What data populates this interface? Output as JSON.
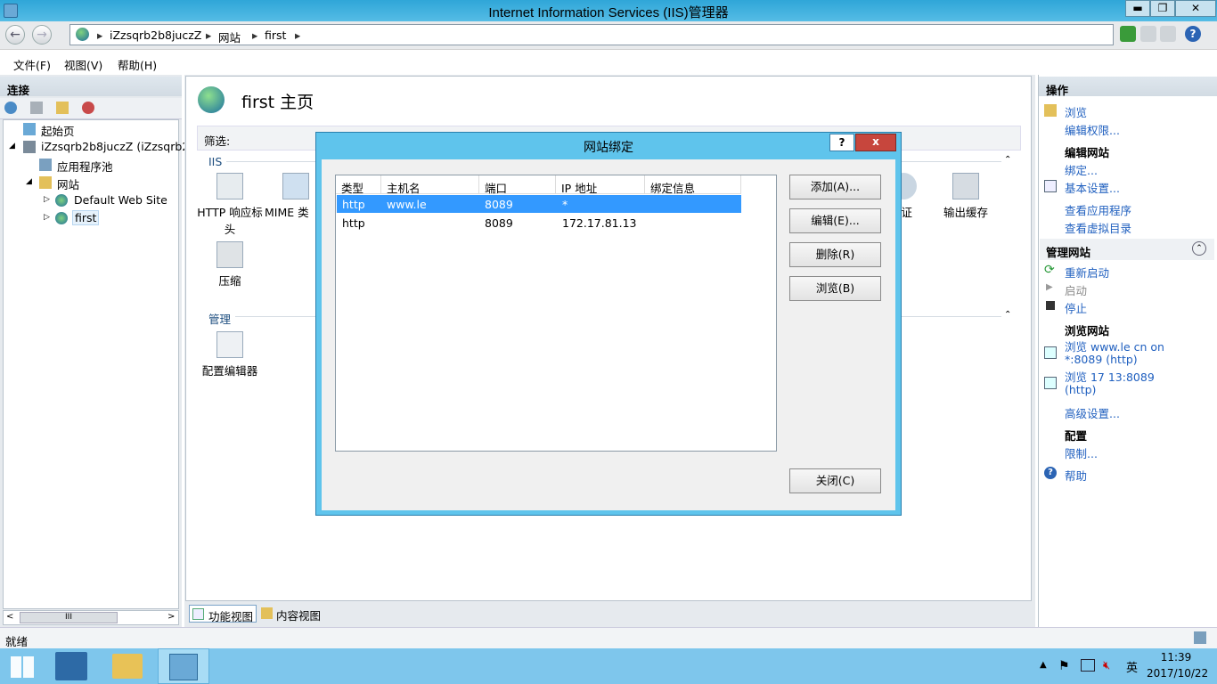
{
  "window": {
    "title": "Internet Information Services (IIS)管理器",
    "min_label": "▬",
    "max_label": "❐",
    "close_label": "✕"
  },
  "address": {
    "crumbs": [
      "iZzsqrb2b8juczZ",
      "网站",
      "first"
    ],
    "separator": "▸"
  },
  "menu": [
    "文件(F)",
    "视图(V)",
    "帮助(H)"
  ],
  "connections": {
    "title": "连接",
    "tree": [
      {
        "label": "起始页"
      },
      {
        "label": "iZzsqrb2b8juczZ (iZzsqrb2b"
      },
      {
        "label": "应用程序池"
      },
      {
        "label": "网站"
      },
      {
        "label": "Default Web Site"
      },
      {
        "label": "first"
      }
    ],
    "scroll_thumb": "III"
  },
  "home": {
    "title": "first 主页",
    "filter_label": "筛选:",
    "iis_section": "IIS",
    "features": [
      {
        "label": "HTTP 响应标头"
      },
      {
        "label": "MIME 类"
      },
      {
        "label": "压缩"
      },
      {
        "label": "验证"
      },
      {
        "label": "输出缓存"
      }
    ],
    "manage_section": "管理",
    "manage_features": [
      {
        "label": "配置编辑器"
      }
    ],
    "view_tabs": [
      "功能视图",
      "内容视图"
    ]
  },
  "actions": {
    "title": "操作",
    "browse": "浏览",
    "edit_perms": "编辑权限...",
    "edit_site_head": "编辑网站",
    "bindings": "绑定...",
    "basic_settings": "基本设置...",
    "view_apps": "查看应用程序",
    "view_vdirs": "查看虚拟目录",
    "manage_site_head": "管理网站",
    "restart": "重新启动",
    "start": "启动",
    "stop": "停止",
    "browse_site_head": "浏览网站",
    "browse_1a": "浏览 www.le          cn on",
    "browse_1b": "*:8089 (http)",
    "browse_2a": "浏览 17        13:8089",
    "browse_2b": "(http)",
    "advanced": "高级设置...",
    "config_head": "配置",
    "limits": "限制...",
    "help": "帮助"
  },
  "status": {
    "text": "就绪"
  },
  "taskbar": {
    "time": "11:39",
    "date": "2017/10/22",
    "ime": "英"
  },
  "dialog": {
    "title": "网站绑定",
    "help_btn": "?",
    "close_btn": "x",
    "columns": [
      "类型",
      "主机名",
      "端口",
      "IP 地址",
      "绑定信息"
    ],
    "rows": [
      {
        "type": "http",
        "host": "www.le",
        "port": "8089",
        "ip": "*",
        "info": ""
      },
      {
        "type": "http",
        "host": "",
        "port": "8089",
        "ip": "172.17.81.13",
        "info": ""
      }
    ],
    "buttons": {
      "add": "添加(A)...",
      "edit": "编辑(E)...",
      "remove": "删除(R)",
      "browse": "浏览(B)",
      "close": "关闭(C)"
    }
  },
  "colors": {
    "link": "#1f5fbf",
    "selection": "#3399ff",
    "taskbar": "#7ec6ec",
    "dialog_frame": "#5fc4ec"
  }
}
